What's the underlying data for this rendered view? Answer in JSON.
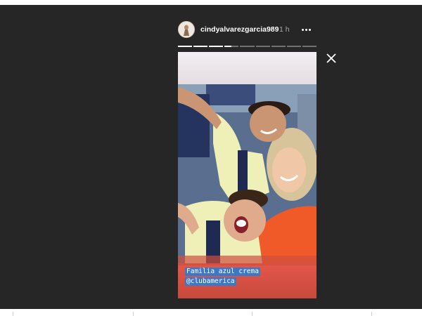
{
  "story": {
    "username": "cindyalvarezgarcia989",
    "timestamp": "1 h",
    "progress": {
      "segments": 9,
      "completed": 3,
      "current_fraction": 0.5
    },
    "caption_line1": "Familia azul crema",
    "caption_line2": "@clubamerica",
    "icons": {
      "more": "more-options-icon",
      "close": "close-icon"
    }
  },
  "colors": {
    "viewer_background": "#262626",
    "caption_highlight": "#3b78c7",
    "jersey_yellow": "#eef0b8",
    "jersey_navy": "#1f2a52",
    "orange_shirt": "#f05a28"
  }
}
